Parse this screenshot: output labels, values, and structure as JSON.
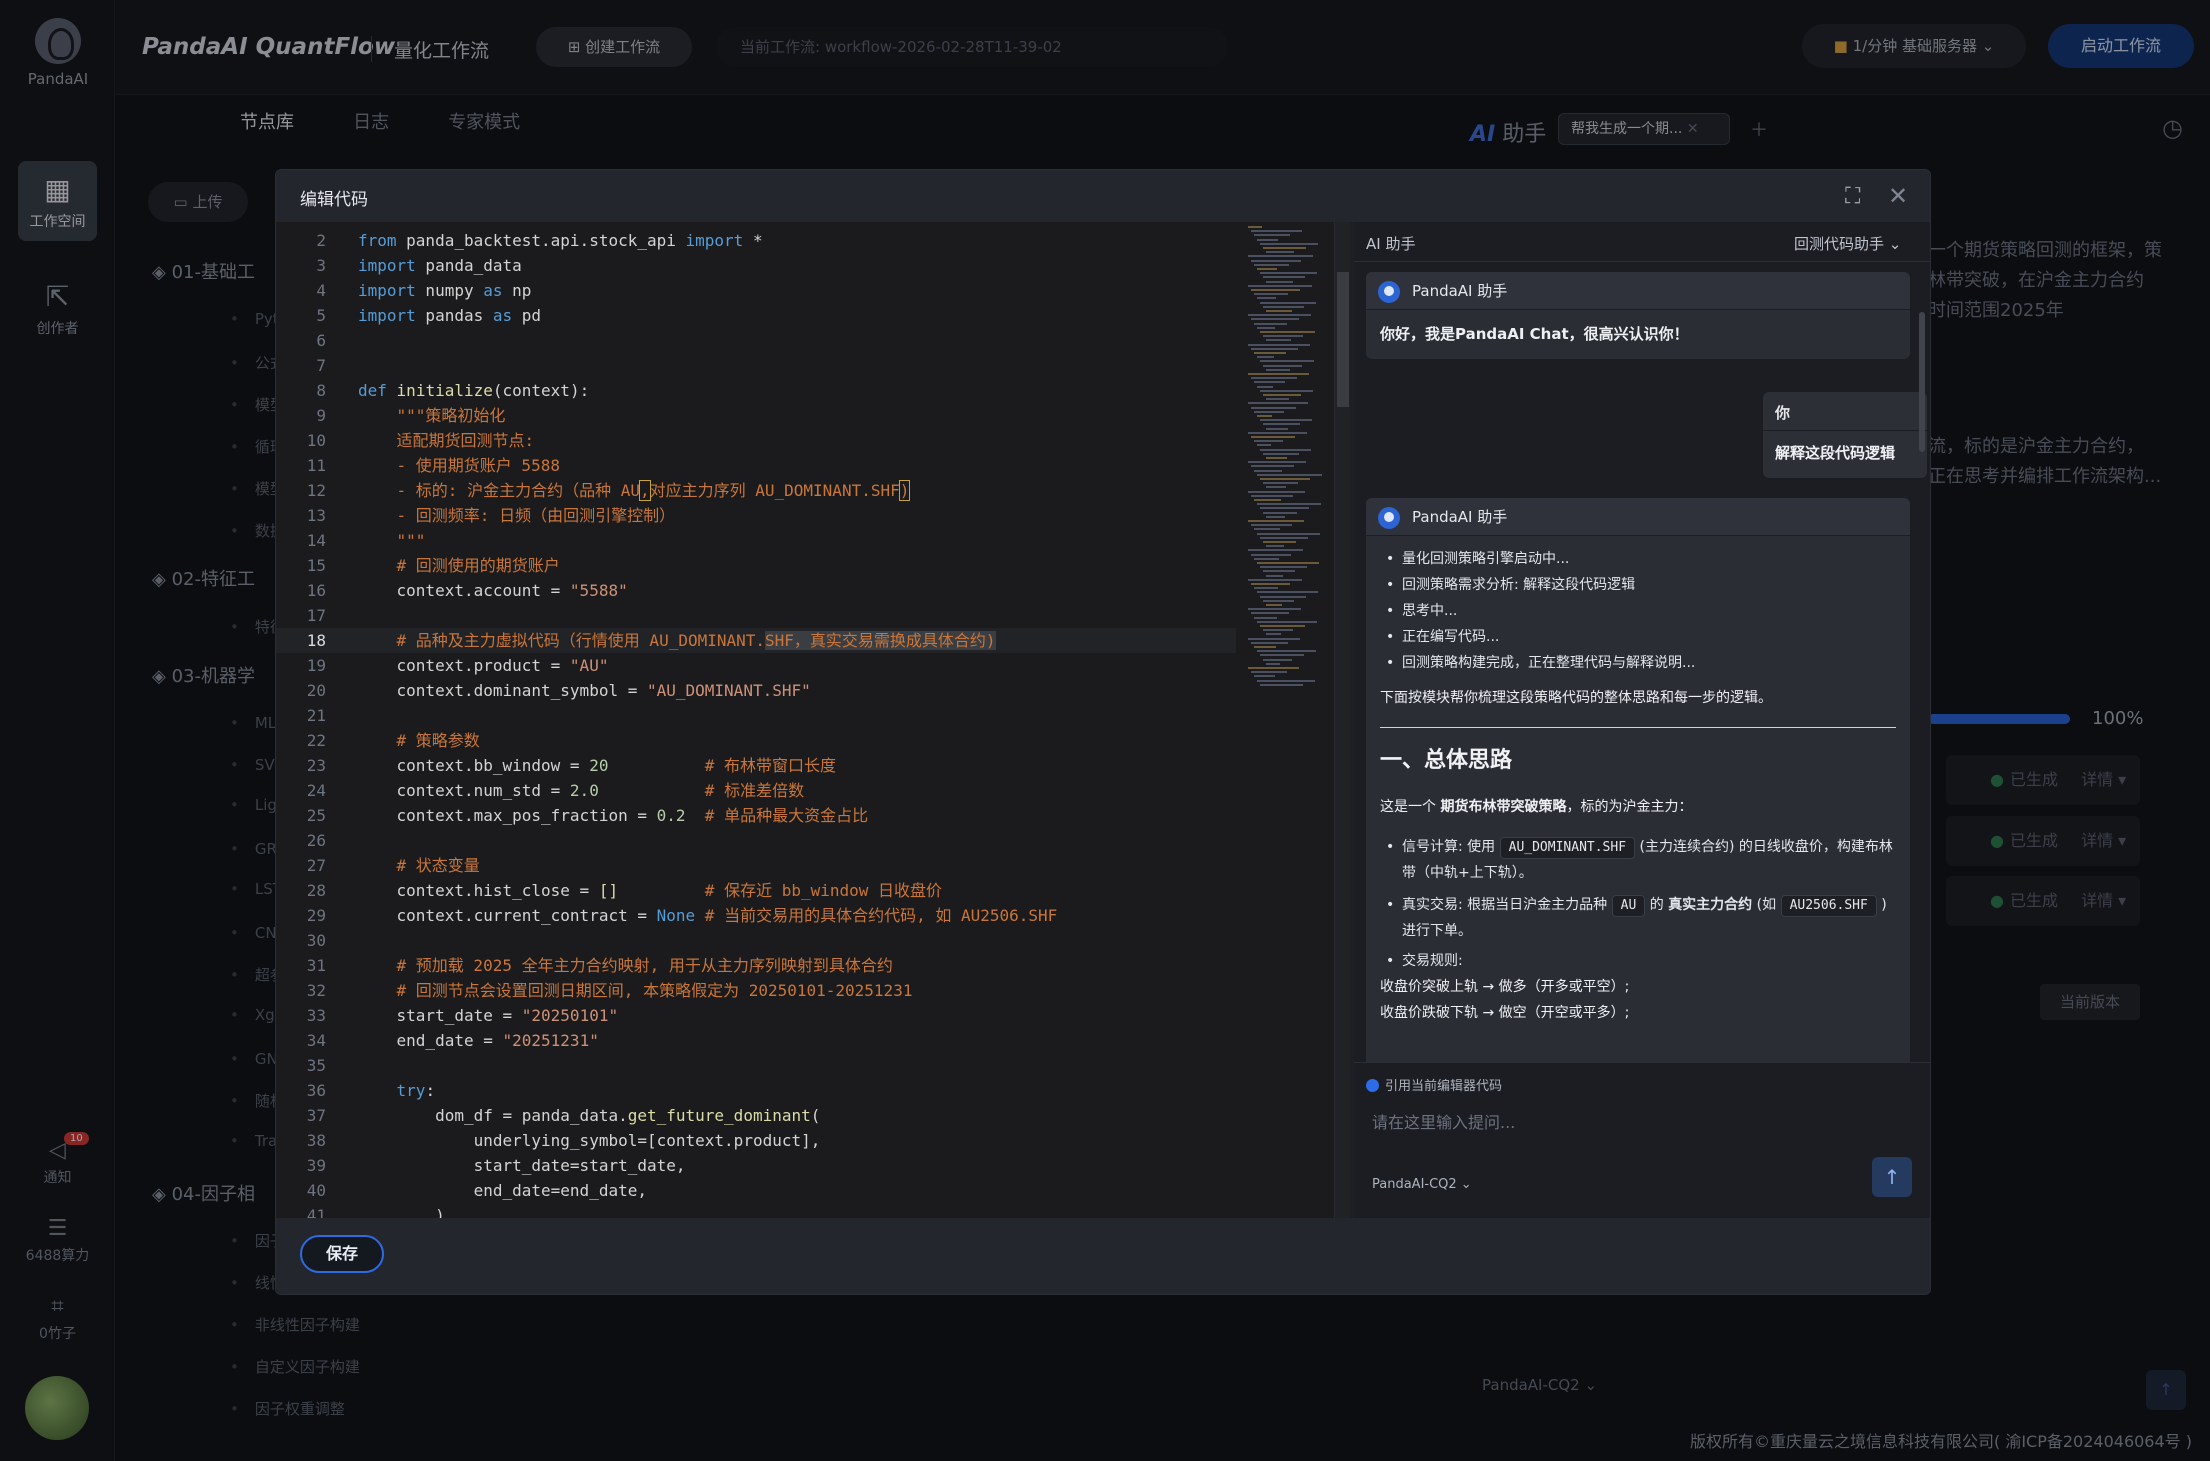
{
  "rail": {
    "logo_text": "PandaAI",
    "workspace": "工作空间",
    "creator": "创作者",
    "notice": "通知",
    "notice_count": "10",
    "compute": "6488算力",
    "bamboo": "0竹子"
  },
  "topbar": {
    "brand": "PandaAI QuantFlow",
    "subtitle": "量化工作流",
    "create_button": "创建工作流",
    "current_workflow": "当前工作流:  workflow-2026-02-28T11-39-02",
    "rate": "1/分钟  基础服务器",
    "start_button": "启动工作流"
  },
  "tabs": [
    "节点库",
    "日志",
    "专家模式"
  ],
  "leftpanel": {
    "upload": "上传",
    "groups": [
      "01-基础工",
      "02-特征工",
      "03-机器学",
      "04-因子相"
    ],
    "children": [
      "Pytho",
      "公式输",
      "模型上",
      "循环控",
      "模型下",
      "数据下",
      "特征工",
      "MLP模",
      "SVM模",
      "LightG",
      "GRU模",
      "LSTM",
      "CNN模",
      "超参数",
      "Xgboo",
      "GNN模",
      "随机森",
      "Transf",
      "因子分",
      "线性因",
      "非线性因子构建",
      "自定义因子构建",
      "因子权重调整"
    ]
  },
  "assistant_bg": {
    "title_ai": "AI",
    "title_rest": "助手",
    "tab": "帮我生成一个期...",
    "text1": [
      "一个期货策略回测的框架，策",
      "林带突破，在沪金主力合约",
      "时间范围2025年"
    ],
    "text2": [
      "流，标的是沪金主力合约，",
      "正在思考并编排工作流架构..."
    ],
    "progress": 100,
    "pct": "100%",
    "status": [
      "已生成",
      "已生成",
      "已生成"
    ],
    "detail": "详情 ▾",
    "version": "当前版本",
    "model": "PandaAI-CQ2  ⌄",
    "footer": "版权所有©重庆量云之境信息科技有限公司( 渝ICP备2024046064号 )"
  },
  "modal": {
    "title": "编辑代码",
    "save": "保存",
    "code": [
      {
        "n": "2",
        "h": "<span class='kw'>from</span> panda_backtest.api.stock_api <span class='kw'>import</span> *"
      },
      {
        "n": "3",
        "h": "<span class='kw'>import</span> panda_data"
      },
      {
        "n": "4",
        "h": "<span class='kw'>import</span> numpy <span class='kw'>as</span> np"
      },
      {
        "n": "5",
        "h": "<span class='kw'>import</span> pandas <span class='kw'>as</span> pd"
      },
      {
        "n": "6",
        "h": ""
      },
      {
        "n": "7",
        "h": ""
      },
      {
        "n": "8",
        "h": "<span class='kw'>def</span> <span class='fn'>initialize</span>(context):"
      },
      {
        "n": "9",
        "h": "    <span class='cmz'>\"\"\"策略初始化</span>"
      },
      {
        "n": "10",
        "h": "    <span class='cmz'>适配期货回测节点:</span>"
      },
      {
        "n": "11",
        "h": "    <span class='cmz'>- 使用期货账户 5588</span>"
      },
      {
        "n": "12",
        "h": "    <span class='cmz'>- 标的: 沪金主力合约（品种 AU<span class='box'>,</span>对应主力序列 AU_DOMINANT.SHF<span class='box'>)</span></span>"
      },
      {
        "n": "13",
        "h": "    <span class='cmz'>- 回测频率: 日频（由回测引擎控制）</span>"
      },
      {
        "n": "14",
        "h": "    <span class='cmz'>\"\"\"</span>"
      },
      {
        "n": "15",
        "h": "    <span class='cmz'># 回测使用的期货账户</span>"
      },
      {
        "n": "16",
        "h": "    context.account = <span class='st'>\"5588\"</span>"
      },
      {
        "n": "17",
        "h": ""
      },
      {
        "n": "18",
        "h": "    <span class='cmz'># 品种及主力虚拟代码（行情使用 AU_DOMINANT.<span class='hl'>SHF，真实交易需换成具体合约)</span></span>",
        "cur": true
      },
      {
        "n": "19",
        "h": "    context.product = <span class='st'>\"AU\"</span>"
      },
      {
        "n": "20",
        "h": "    context.dominant_symbol = <span class='st'>\"AU_DOMINANT.SHF\"</span>"
      },
      {
        "n": "21",
        "h": ""
      },
      {
        "n": "22",
        "h": "    <span class='cmz'># 策略参数</span>"
      },
      {
        "n": "23",
        "h": "    context.bb_window = <span class='nm'>20</span>          <span class='cmz'># 布林带窗口长度</span>"
      },
      {
        "n": "24",
        "h": "    context.num_std = <span class='nm'>2.0</span>           <span class='cmz'># 标准差倍数</span>"
      },
      {
        "n": "25",
        "h": "    context.max_pos_fraction = <span class='nm'>0.2</span>  <span class='cmz'># 单品种最大资金占比</span>"
      },
      {
        "n": "26",
        "h": ""
      },
      {
        "n": "27",
        "h": "    <span class='cmz'># 状态变量</span>"
      },
      {
        "n": "28",
        "h": "    context.hist_close = <span class='fn'>[]</span>         <span class='cmz'># 保存近 bb_window 日收盘价</span>"
      },
      {
        "n": "29",
        "h": "    context.current_contract = <span class='kw'>None</span> <span class='cmz'># 当前交易用的具体合约代码, 如 AU2506.SHF</span>"
      },
      {
        "n": "30",
        "h": ""
      },
      {
        "n": "31",
        "h": "    <span class='cmz'># 预加载 2025 全年主力合约映射, 用于从主力序列映射到具体合约</span>"
      },
      {
        "n": "32",
        "h": "    <span class='cmz'># 回测节点会设置回测日期区间, 本策略假定为 20250101-20251231</span>"
      },
      {
        "n": "33",
        "h": "    start_date = <span class='st'>\"20250101\"</span>"
      },
      {
        "n": "34",
        "h": "    end_date = <span class='st'>\"20251231\"</span>"
      },
      {
        "n": "35",
        "h": ""
      },
      {
        "n": "36",
        "h": "    <span class='kw'>try</span>:"
      },
      {
        "n": "37",
        "h": "        dom_df = panda_data.<span class='fn'>get_future_dominant</span>("
      },
      {
        "n": "38",
        "h": "            underlying_symbol=[context.product],"
      },
      {
        "n": "39",
        "h": "            start_date=start_date,"
      },
      {
        "n": "40",
        "h": "            end_date=end_date,"
      },
      {
        "n": "41",
        "h": "        )"
      }
    ]
  },
  "ai": {
    "header": "AI 助手",
    "mode": "回测代码助手 ⌄",
    "bot_name": "PandaAI 助手",
    "greeting": "你好，我是PandaAI Chat，很高兴认识你！",
    "user_label": "你",
    "user_question": "解释这段代码逻辑",
    "steps": [
      "量化回测策略引擎启动中...",
      "回测策略需求分析:  解释这段代码逻辑",
      "思考中...",
      "正在编写代码...",
      "回测策略构建完成，正在整理代码与解释说明..."
    ],
    "intro": "下面按模块帮你梳理这段策略代码的整体思路和每一步的逻辑。",
    "section_title": "一、总体思路",
    "summary_pre": "这是一个 ",
    "summary_bold": "期货布林带突破策略",
    "summary_post": "，标的为沪金主力：",
    "point1_a": "信号计算: 使用 ",
    "point1_code": "AU_DOMINANT.SHF",
    "point1_b": " (主力连续合约) 的日线收盘价，构建布林带（中轨+上下轨）。",
    "point2_a": "真实交易: 根据当日沪金主力品种 ",
    "point2_code": "AU",
    "point2_b": " 的 ",
    "point2_bold": "真实主力合约",
    "point2_c": " (如 ",
    "point2_code2": "AU2506.SHF",
    "point2_d": " ) 进行下单。",
    "point3": "交易规则:",
    "rule1": "收盘价突破上轨 → 做多（开多或平空）;",
    "rule2": "收盘价跌破下轨 → 做空（开空或平多）;",
    "cite": "引用当前编辑器代码",
    "placeholder": "请在这里输入提问...",
    "model": "PandaAI-CQ2 ⌄"
  }
}
